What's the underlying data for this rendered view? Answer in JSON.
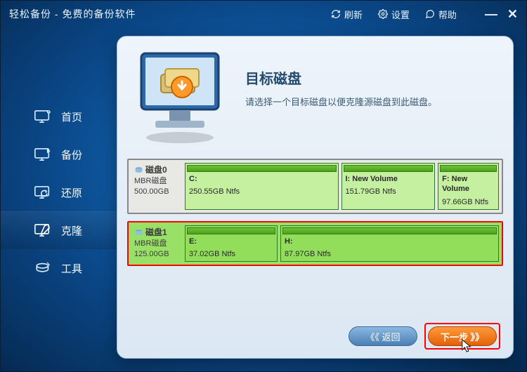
{
  "app": {
    "title": "轻松备份 - 免费的备份软件"
  },
  "top": {
    "refresh": "刷新",
    "settings": "设置",
    "help": "帮助"
  },
  "sidebar": {
    "items": [
      {
        "id": "home",
        "label": "首页"
      },
      {
        "id": "backup",
        "label": "备份"
      },
      {
        "id": "restore",
        "label": "还原"
      },
      {
        "id": "clone",
        "label": "克隆"
      },
      {
        "id": "tools",
        "label": "工具"
      }
    ],
    "active": "clone"
  },
  "panel": {
    "heading": "目标磁盘",
    "subheading": "请选择一个目标磁盘以便克隆源磁盘到此磁盘。"
  },
  "disks": [
    {
      "name": "磁盘0",
      "type": "MBR磁盘",
      "size": "500.00GB",
      "selected": false,
      "partitions": [
        {
          "label": "C:",
          "size": "250.55GB Ntfs"
        },
        {
          "label": "I: New Volume",
          "size": "151.79GB Ntfs"
        },
        {
          "label": "F: New Volume",
          "size": "97.66GB Ntfs"
        }
      ]
    },
    {
      "name": "磁盘1",
      "type": "MBR磁盘",
      "size": "125.00GB",
      "selected": true,
      "partitions": [
        {
          "label": "E:",
          "size": "37.02GB Ntfs"
        },
        {
          "label": "H:",
          "size": "87.97GB Ntfs"
        }
      ]
    }
  ],
  "buttons": {
    "back": "《《 返回",
    "next": "下一步 》》"
  },
  "colors": {
    "accent_orange": "#ff7a1a",
    "selection_red": "#ff0000",
    "partition_green": "#92dd59",
    "bg_blue_dark": "#052a52",
    "bg_blue_light": "#1876c8"
  }
}
